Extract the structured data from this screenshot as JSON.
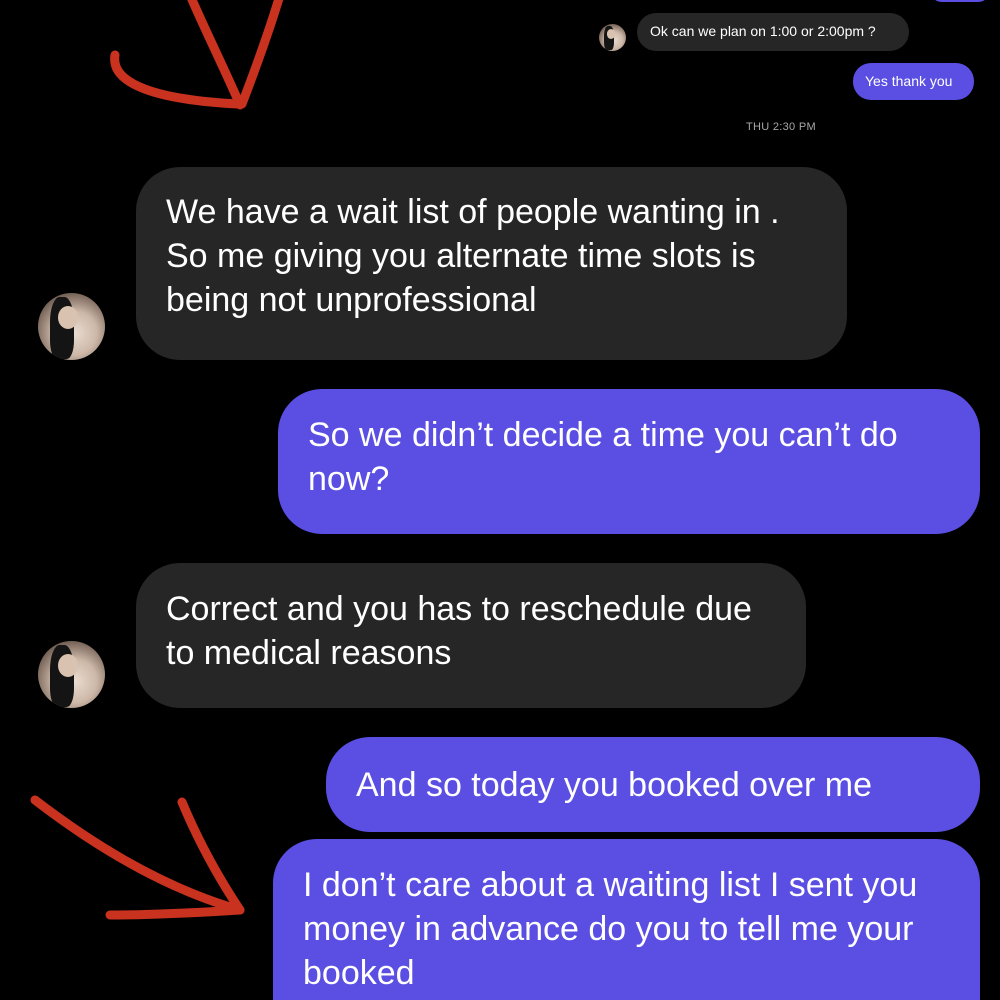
{
  "conversation": {
    "top": {
      "incoming_message": "Ok can we plan on 1:00 or 2:00pm ?",
      "outgoing_message": "Yes thank you",
      "timestamp": "THU 2:30 PM"
    },
    "messages": [
      {
        "direction": "incoming",
        "text": "We have a wait list of people wanting in . So me giving you alternate time slots is being not unprofessional"
      },
      {
        "direction": "outgoing",
        "text": "So we didn’t decide a time you can’t do now?"
      },
      {
        "direction": "incoming",
        "text": "Correct and you has to reschedule due to medical reasons"
      },
      {
        "direction": "outgoing",
        "text": "And so today you booked over me"
      },
      {
        "direction": "outgoing",
        "text": "I don’t care about a waiting list I sent you money in advance do you to tell me your booked"
      }
    ]
  },
  "annotations": {
    "arrow_color": "#c8321f",
    "arrows": [
      "red-arrow-top",
      "red-arrow-bottom"
    ]
  },
  "colors": {
    "background": "#000000",
    "incoming_bubble": "#262626",
    "outgoing_bubble": "#5b4fe3",
    "timestamp": "#a8a8a8"
  }
}
